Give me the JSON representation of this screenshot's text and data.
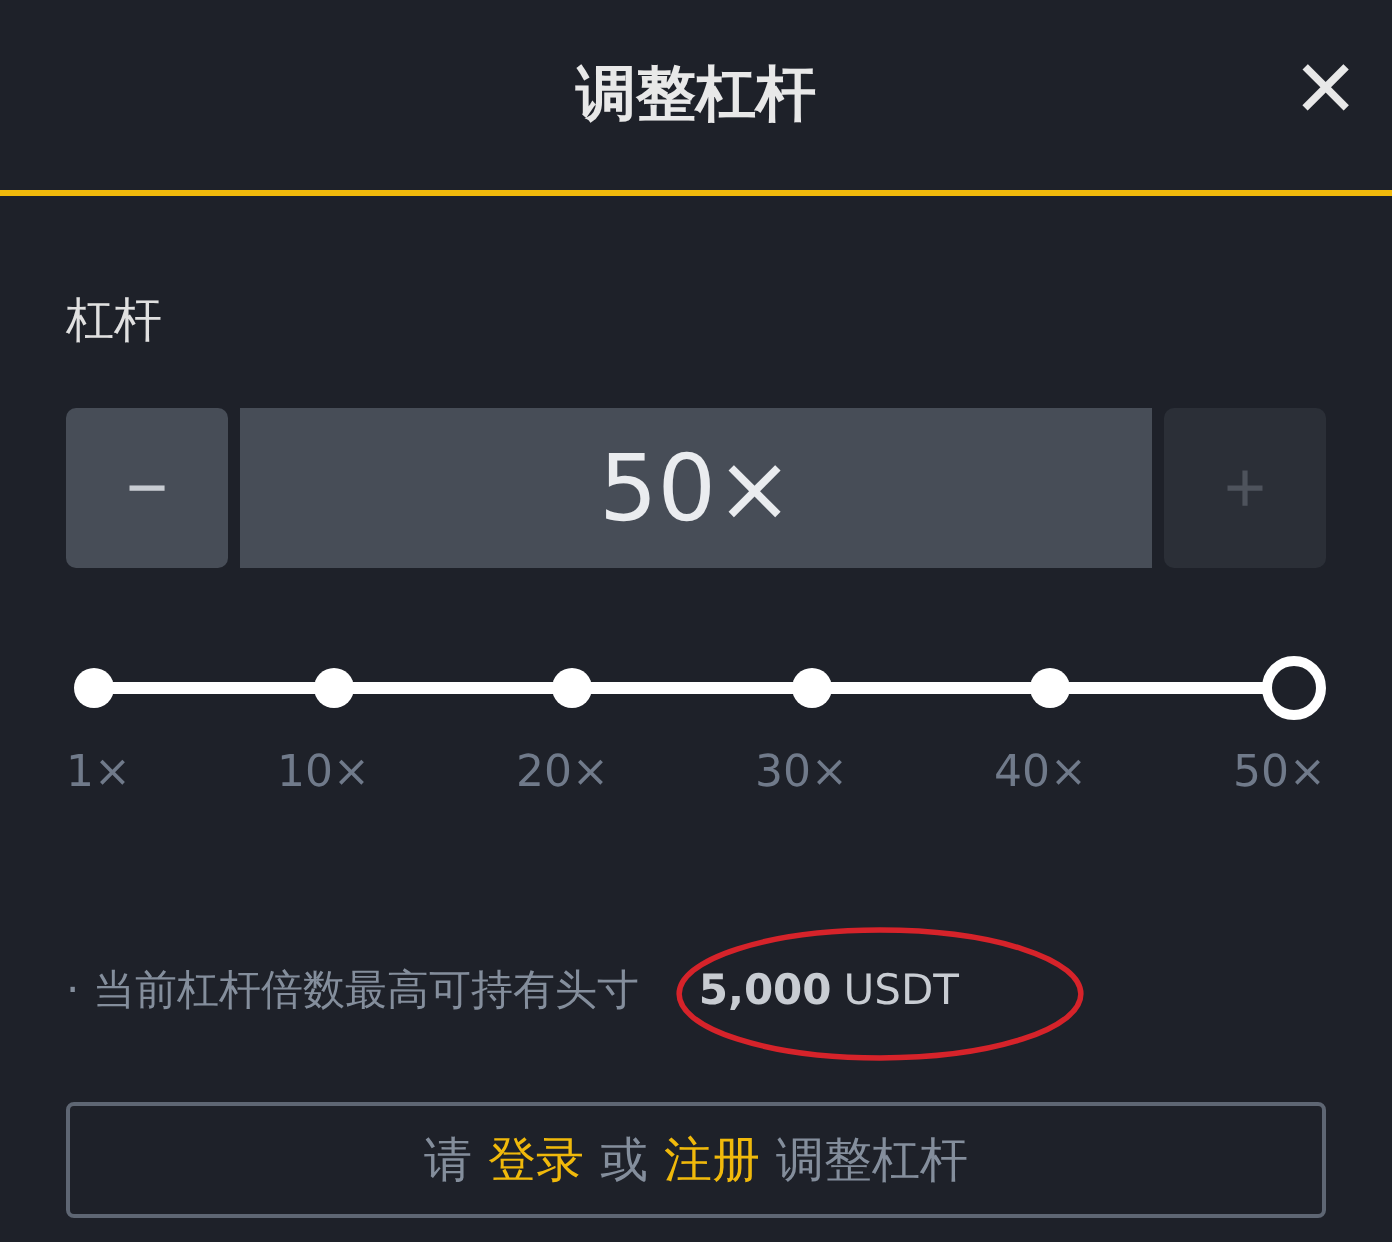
{
  "header": {
    "title": "调整杠杆",
    "close": "×"
  },
  "leverage": {
    "label": "杠杆",
    "value": "50×",
    "decrement": {
      "label": "−",
      "disabled": false
    },
    "increment": {
      "label": "+",
      "disabled": true
    }
  },
  "slider": {
    "marks": [
      {
        "label": "1×",
        "selected": false
      },
      {
        "label": "10×",
        "selected": false
      },
      {
        "label": "20×",
        "selected": false
      },
      {
        "label": "30×",
        "selected": false
      },
      {
        "label": "40×",
        "selected": false
      },
      {
        "label": "50×",
        "selected": true
      }
    ]
  },
  "info": {
    "text": "· 当前杠杆倍数最高可持有头寸",
    "amount": "5,000",
    "unit": "USDT"
  },
  "action": {
    "parts": [
      {
        "kind": "text",
        "text": "请"
      },
      {
        "kind": "link",
        "text": "登录"
      },
      {
        "kind": "text",
        "text": "或"
      },
      {
        "kind": "link",
        "text": "注册"
      },
      {
        "kind": "text",
        "text": "调整杠杆"
      }
    ]
  }
}
